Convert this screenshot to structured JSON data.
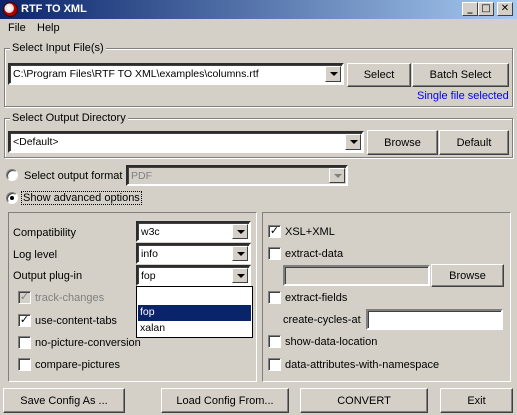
{
  "window": {
    "title": "RTF TO XML",
    "minimize": "_",
    "maximize": "□",
    "close": "✕"
  },
  "menu": {
    "file": "File",
    "help": "Help"
  },
  "input": {
    "group_label": "Select Input File(s)",
    "path": "C:\\Program Files\\RTF TO XML\\examples\\columns.rtf",
    "select_label": "Select",
    "batch_label": "Batch Select",
    "status": "Single file selected",
    "status_color": "#0000ff"
  },
  "output_dir": {
    "group_label": "Select Output Directory",
    "value": "<Default>",
    "browse_label": "Browse",
    "default_label": "Default"
  },
  "format": {
    "radio_label": "Select output format",
    "value": "PDF",
    "checked": false
  },
  "advanced": {
    "radio_label": "Show advanced options",
    "checked": true
  },
  "left_panel": {
    "compatibility_label": "Compatibility",
    "compatibility_value": "w3c",
    "log_level_label": "Log level",
    "log_level_value": "info",
    "plugin_label": "Output plug-in",
    "plugin_value": "fop",
    "plugin_options": [
      "",
      "fop",
      "xalan"
    ],
    "plugin_selected_index": 1,
    "track_changes": {
      "label": "track-changes",
      "checked": true,
      "disabled": true
    },
    "use_content_tabs": {
      "label": "use-content-tabs",
      "checked": true
    },
    "no_picture_conversion": {
      "label": "no-picture-conversion",
      "checked": false
    },
    "compare_pictures": {
      "label": "compare-pictures",
      "checked": false
    }
  },
  "right_panel": {
    "xsl_xml": {
      "label": "XSL+XML",
      "checked": true
    },
    "extract_data": {
      "label": "extract-data",
      "checked": false
    },
    "extract_data_browse": "Browse",
    "extract_fields": {
      "label": "extract-fields",
      "checked": false
    },
    "create_cycles_label": "create-cycles-at",
    "show_data_location": {
      "label": "show-data-location",
      "checked": false
    },
    "data_attributes": {
      "label": "data-attributes-with-namespace",
      "checked": false
    }
  },
  "footer": {
    "save_config": "Save Config As ...",
    "load_config": "Load Config From...",
    "convert": "CONVERT",
    "exit": "Exit"
  },
  "check_mark": "✓"
}
